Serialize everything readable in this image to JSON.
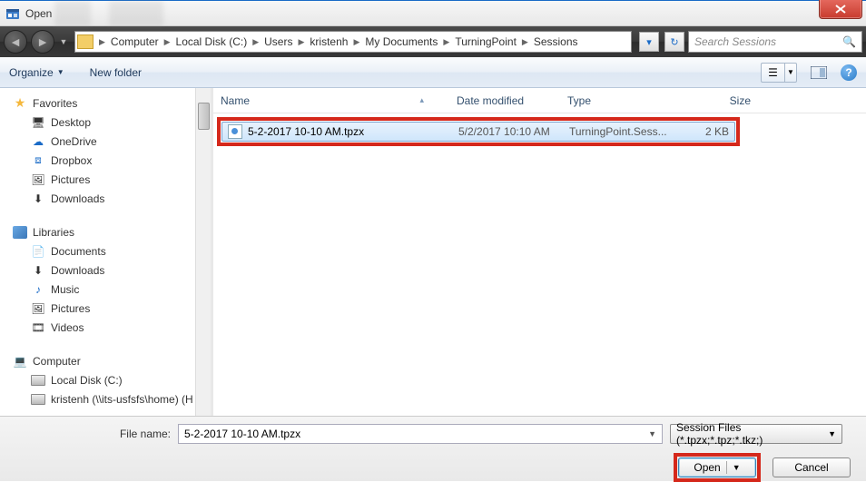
{
  "window": {
    "title": "Open"
  },
  "breadcrumbs": [
    "Computer",
    "Local Disk (C:)",
    "Users",
    "kristenh",
    "My Documents",
    "TurningPoint",
    "Sessions"
  ],
  "search": {
    "placeholder": "Search Sessions"
  },
  "toolbar": {
    "organize": "Organize",
    "newfolder": "New folder"
  },
  "columns": {
    "name": "Name",
    "date": "Date modified",
    "type": "Type",
    "size": "Size"
  },
  "sidebar": {
    "favorites": {
      "label": "Favorites",
      "items": [
        "Desktop",
        "OneDrive",
        "Dropbox",
        "Pictures",
        "Downloads"
      ]
    },
    "libraries": {
      "label": "Libraries",
      "items": [
        "Documents",
        "Downloads",
        "Music",
        "Pictures",
        "Videos"
      ]
    },
    "computer": {
      "label": "Computer",
      "items": [
        "Local Disk (C:)",
        "kristenh (\\\\its-usfsfs\\home) (H"
      ]
    }
  },
  "files": [
    {
      "name": "5-2-2017 10-10 AM.tpzx",
      "date": "5/2/2017 10:10 AM",
      "type": "TurningPoint.Sess...",
      "size": "2 KB"
    }
  ],
  "footer": {
    "filename_label": "File name:",
    "filename_value": "5-2-2017 10-10 AM.tpzx",
    "filter": "Session Files (*.tpzx;*.tpz;*.tkz;)",
    "open": "Open",
    "cancel": "Cancel"
  }
}
